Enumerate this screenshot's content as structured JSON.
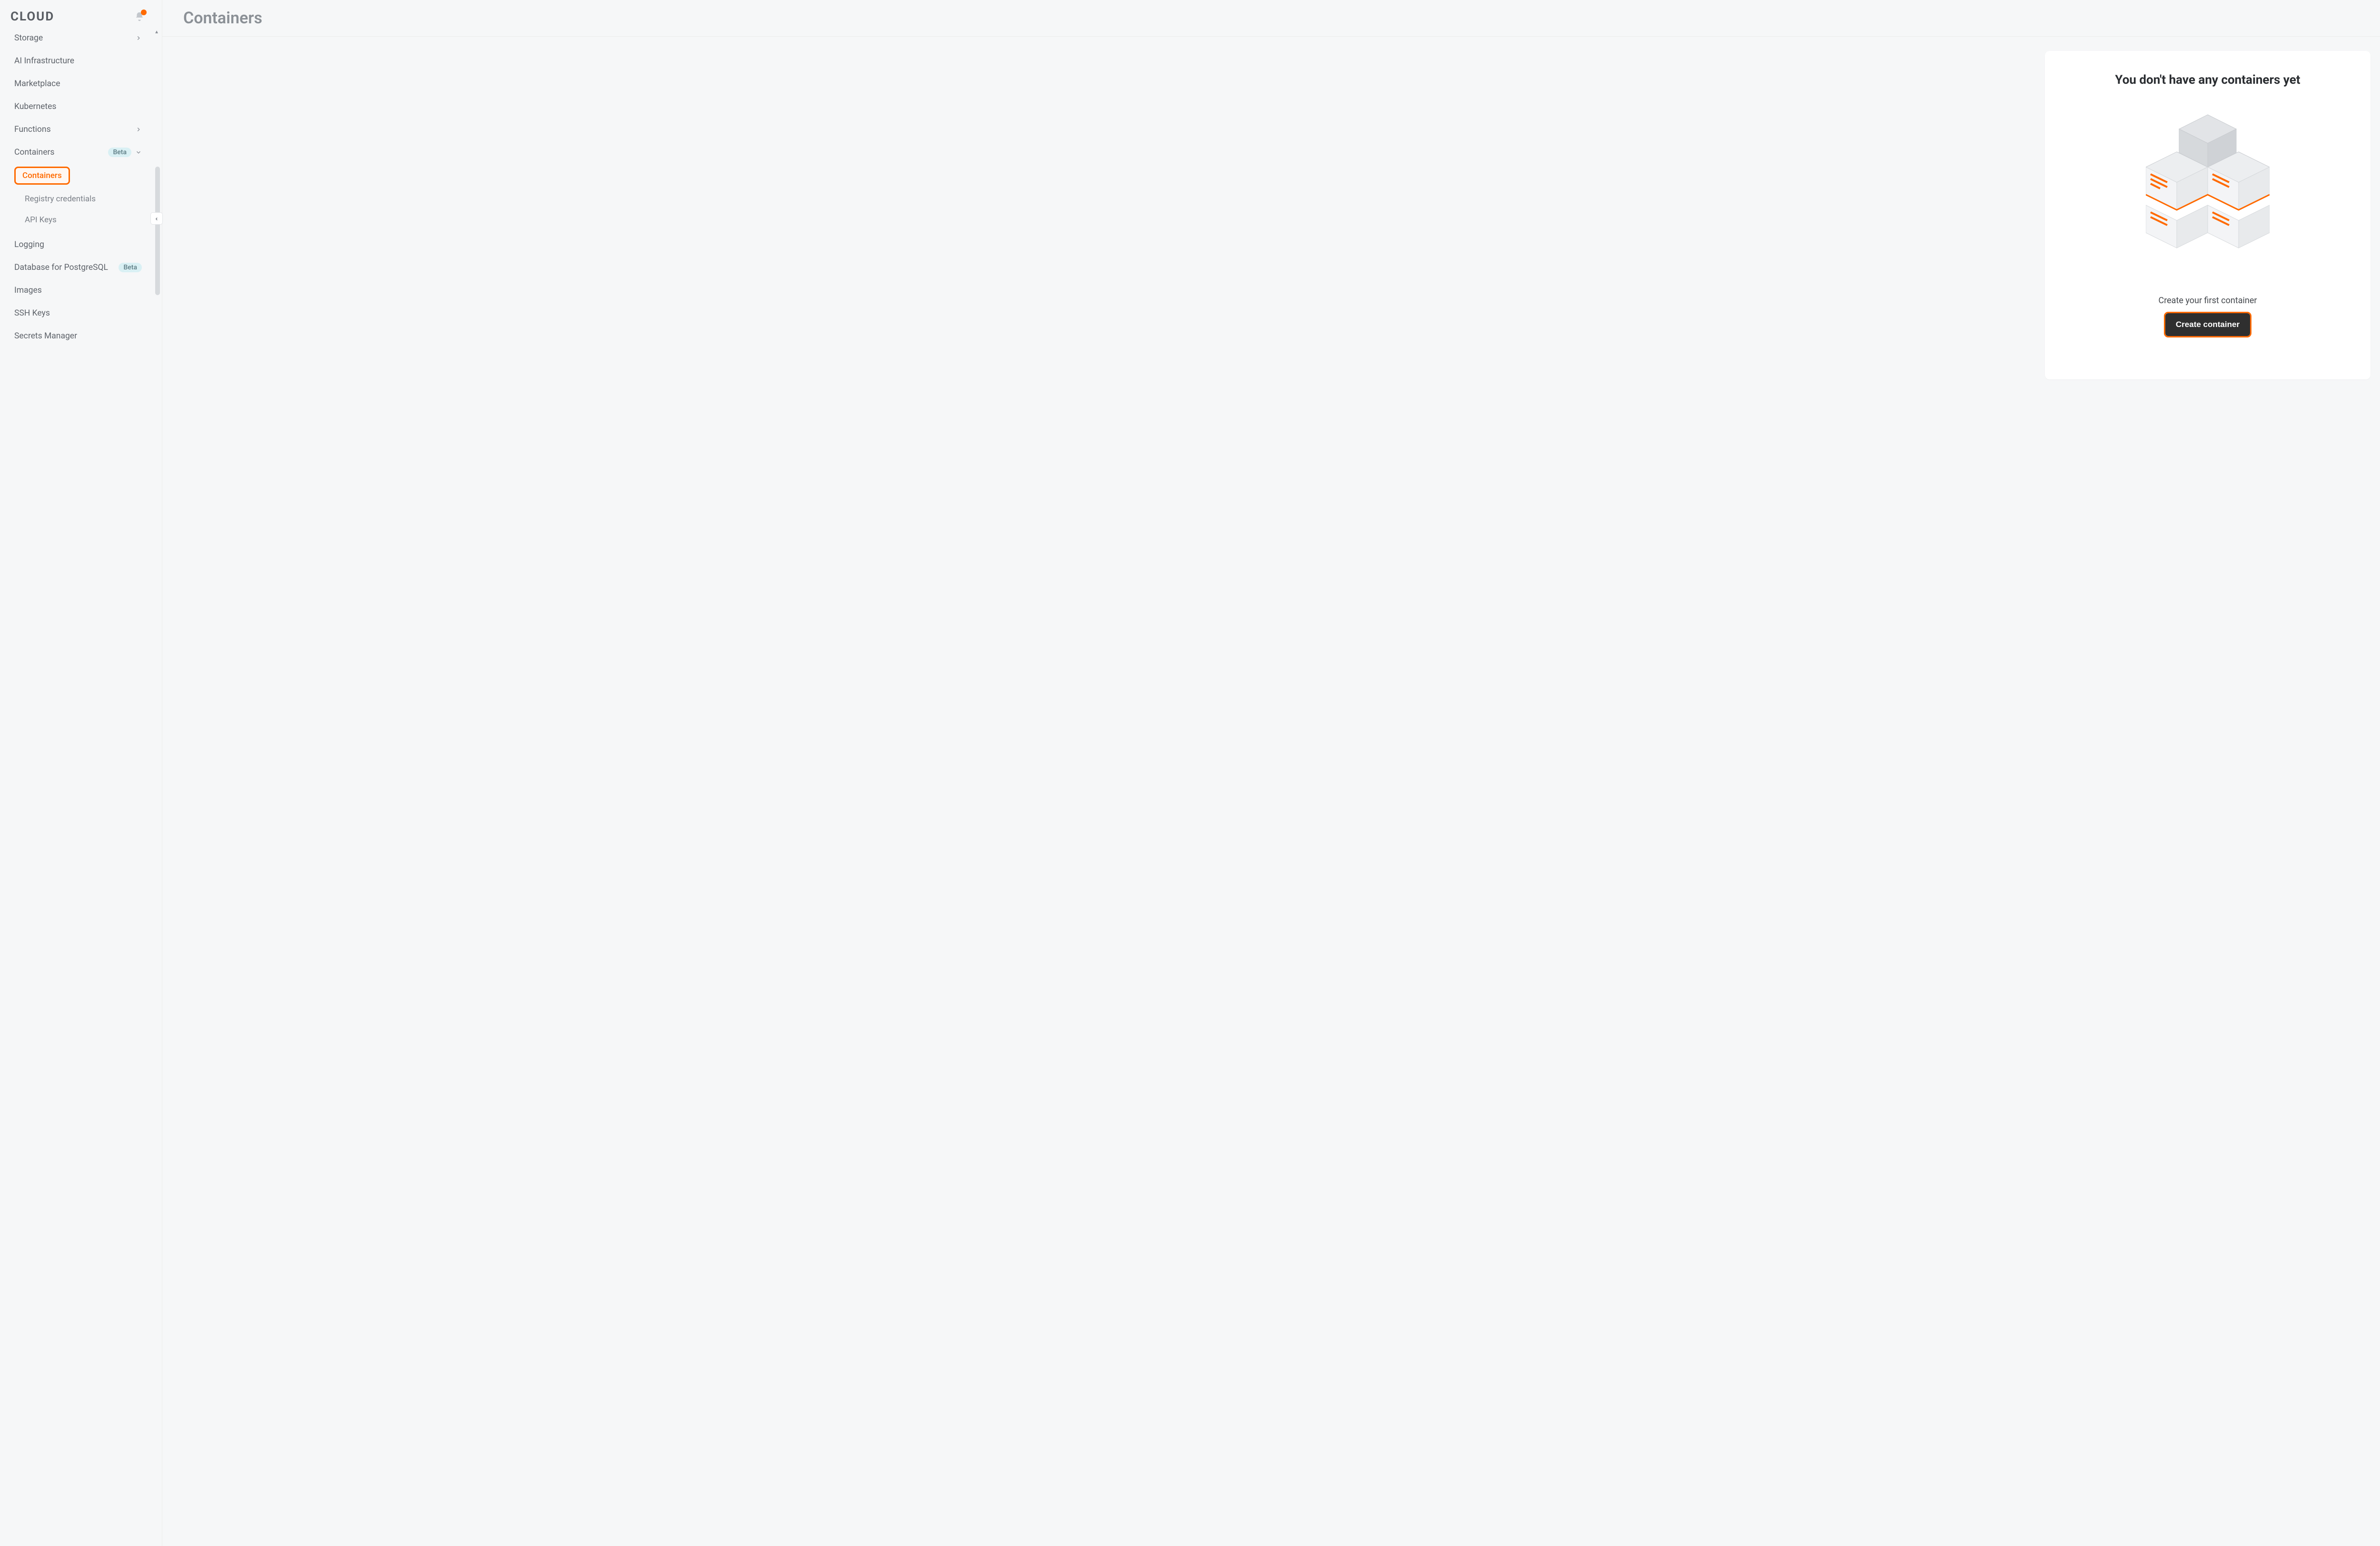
{
  "brand": "CLOUD",
  "sidebar": {
    "items": [
      {
        "label": "Storage",
        "expandable": true,
        "chevron": "right"
      },
      {
        "label": "AI Infrastructure"
      },
      {
        "label": "Marketplace"
      },
      {
        "label": "Kubernetes"
      },
      {
        "label": "Functions",
        "expandable": true,
        "chevron": "right"
      },
      {
        "label": "Containers",
        "badge": "Beta",
        "expandable": true,
        "chevron": "down",
        "children": [
          {
            "label": "Containers",
            "active": true
          },
          {
            "label": "Registry credentials"
          },
          {
            "label": "API Keys"
          }
        ]
      },
      {
        "label": "Logging"
      },
      {
        "label": "Database for PostgreSQL",
        "badge": "Beta"
      },
      {
        "label": "Images"
      },
      {
        "label": "SSH Keys"
      },
      {
        "label": "Secrets Manager"
      }
    ]
  },
  "page": {
    "title": "Containers",
    "empty_heading": "You don't have any containers yet",
    "empty_hint": "Create your first container",
    "cta_label": "Create container"
  },
  "colors": {
    "accent": "#ff6a00",
    "badge_bg": "#d9f0f4"
  }
}
